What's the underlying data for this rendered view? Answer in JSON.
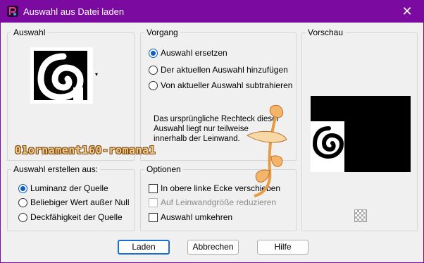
{
  "window": {
    "title": "Auswahl aus Datei laden",
    "close_glyph": "✕",
    "app_icon": "paint-shop-pro-icon"
  },
  "groups": {
    "auswahl": "Auswahl",
    "vorgang": "Vorgang",
    "vorschau": "Vorschau",
    "erstellen": "Auswahl erstellen aus:",
    "optionen": "Optionen"
  },
  "auswahl": {
    "dropdown_arrow": "▾"
  },
  "vorgang": {
    "options": [
      {
        "label": "Auswahl ersetzen",
        "checked": true
      },
      {
        "label": "Der aktuellen Auswahl hinzufügen",
        "checked": false
      },
      {
        "label": "Von aktueller Auswahl subtrahieren",
        "checked": false
      }
    ],
    "note": "Das ursprüngliche Rechteck dieser Auswahl liegt nur teilweise innerhalb der Leinwand."
  },
  "erstellen": {
    "options": [
      {
        "label": "Luminanz der Quelle",
        "checked": true
      },
      {
        "label": "Beliebiger Wert außer Null",
        "checked": false
      },
      {
        "label": "Deckfähigkeit der Quelle",
        "checked": false
      }
    ]
  },
  "optionen": {
    "items": [
      {
        "label": "In obere linke Ecke verschieben",
        "checked": false,
        "disabled": false
      },
      {
        "label": "Auf Leinwandgröße reduzieren",
        "checked": false,
        "disabled": true
      },
      {
        "label": "Auswahl umkehren",
        "checked": false,
        "disabled": false
      }
    ]
  },
  "watermark": {
    "text": "01ornament160-romana1"
  },
  "buttons": {
    "laden": "Laden",
    "abbrechen": "Abbrechen",
    "hilfe": "Hilfe"
  },
  "colors": {
    "titlebar": "#7a0aa0",
    "accent": "#0a5fc0"
  }
}
